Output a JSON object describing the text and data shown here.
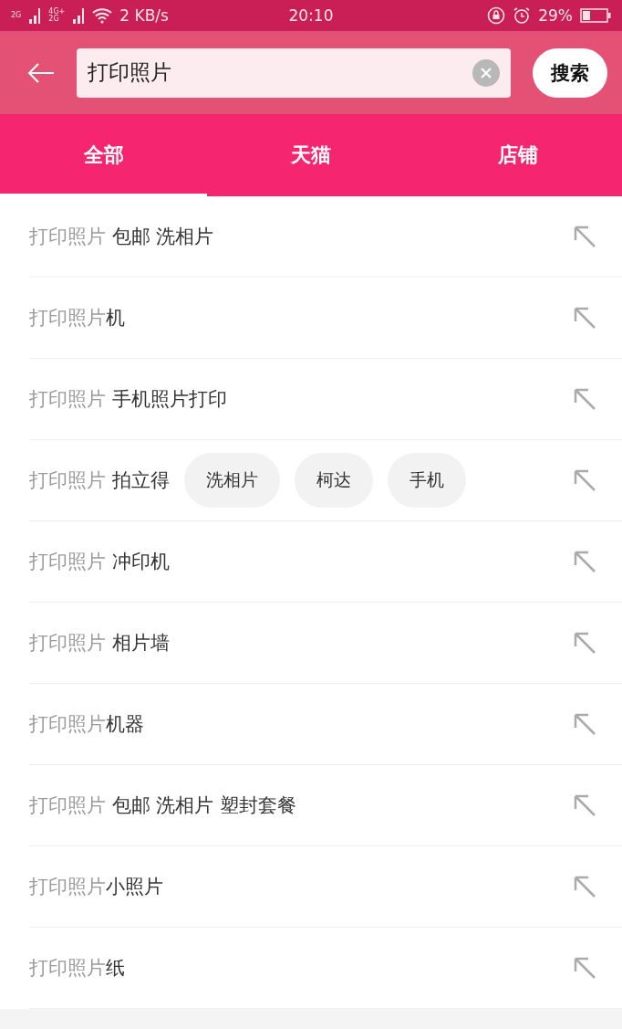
{
  "status_bar": {
    "sim1_label": "2G",
    "sim2_labels": [
      "4G+",
      "2G"
    ],
    "speed": "2 KB/s",
    "time": "20:10",
    "battery": "29%"
  },
  "search": {
    "value": "打印照片",
    "button": "搜索"
  },
  "tabs": [
    {
      "label": "全部",
      "selected": true
    },
    {
      "label": "天猫",
      "selected": false
    },
    {
      "label": "店铺",
      "selected": false
    }
  ],
  "suggestions": [
    {
      "prefix": "打印照片",
      "suffix": " 包邮 洗相片"
    },
    {
      "prefix": "打印照片",
      "suffix": "机"
    },
    {
      "prefix": "打印照片",
      "suffix": " 手机照片打印"
    },
    {
      "prefix": "打印照片",
      "suffix": " 拍立得",
      "chips": [
        "洗相片",
        "柯达",
        "手机"
      ]
    },
    {
      "prefix": "打印照片",
      "suffix": " 冲印机"
    },
    {
      "prefix": "打印照片",
      "suffix": " 相片墙"
    },
    {
      "prefix": "打印照片",
      "suffix": "机器"
    },
    {
      "prefix": "打印照片",
      "suffix": " 包邮 洗相片 塑封套餐"
    },
    {
      "prefix": "打印照片",
      "suffix": "小照片"
    },
    {
      "prefix": "打印照片",
      "suffix": "纸"
    }
  ]
}
